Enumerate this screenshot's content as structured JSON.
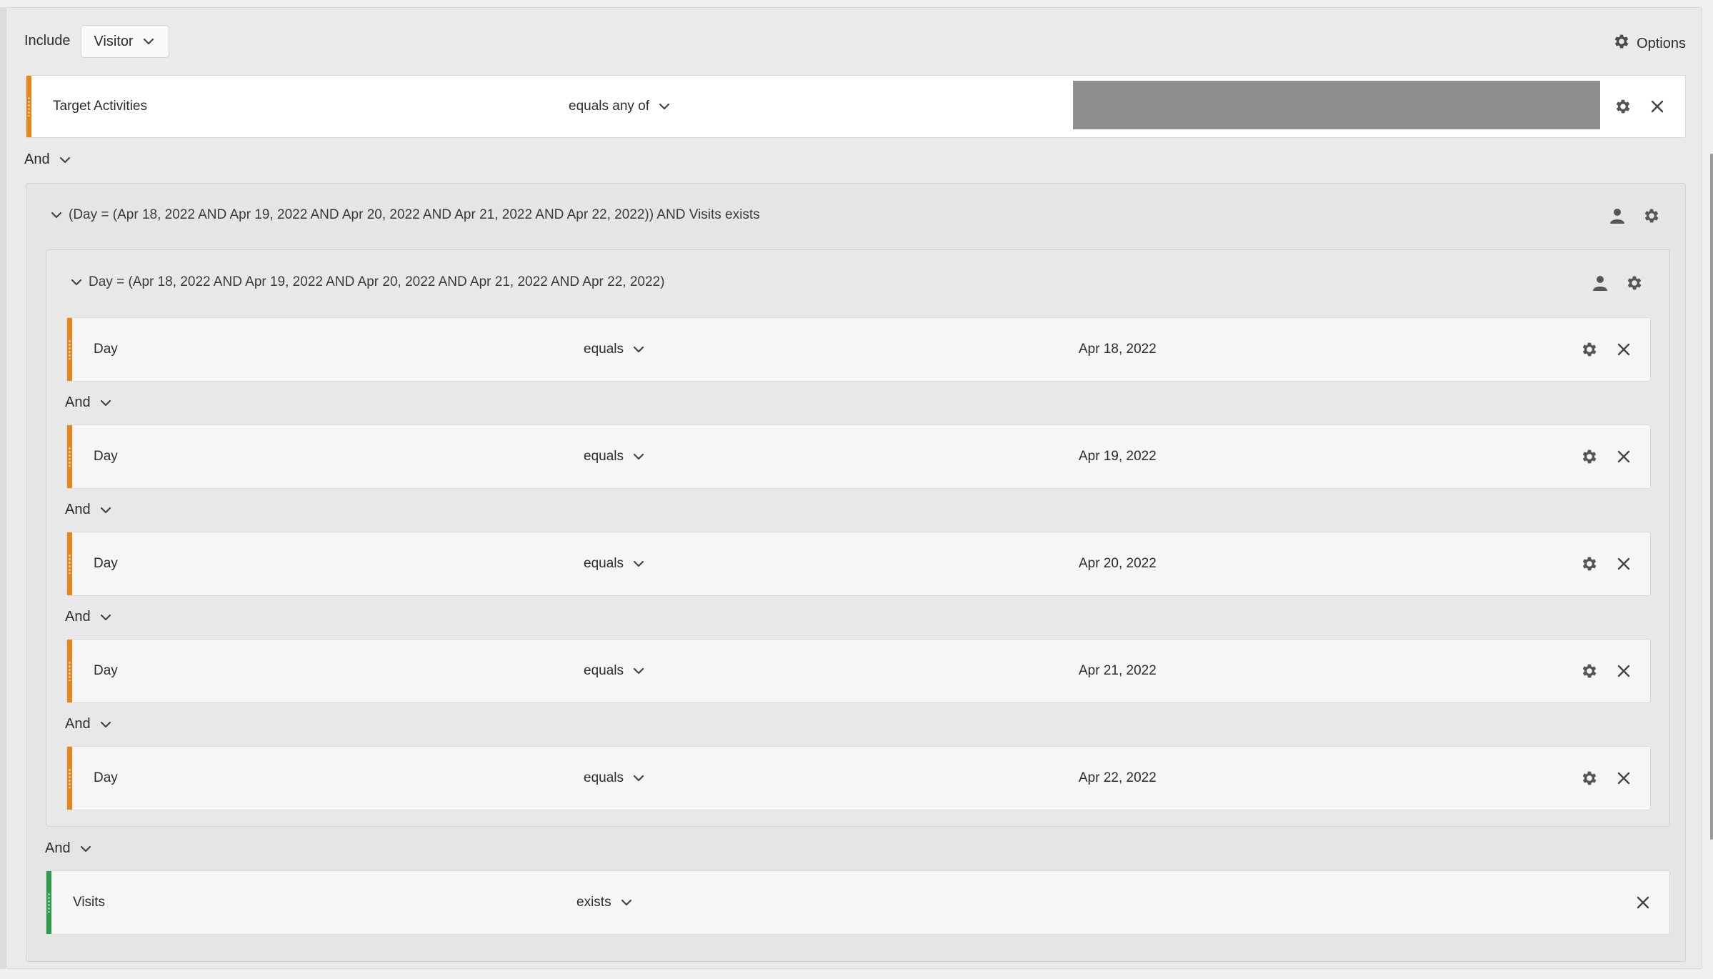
{
  "header": {
    "include_label": "Include",
    "scope_value": "Visitor",
    "options_label": "Options"
  },
  "target_row": {
    "dimension": "Target Activities",
    "operator": "equals any of"
  },
  "outer_container": {
    "title": "(Day = (Apr 18, 2022 AND Apr 19, 2022 AND Apr 20, 2022 AND Apr 21, 2022 AND Apr 22, 2022)) AND Visits exists"
  },
  "inner_container": {
    "title": "Day = (Apr 18, 2022 AND Apr 19, 2022 AND Apr 20, 2022 AND Apr 21, 2022 AND Apr 22, 2022)"
  },
  "connector": "And",
  "day_rows": [
    {
      "dimension": "Day",
      "operator": "equals",
      "value": "Apr 18, 2022"
    },
    {
      "dimension": "Day",
      "operator": "equals",
      "value": "Apr 19, 2022"
    },
    {
      "dimension": "Day",
      "operator": "equals",
      "value": "Apr 20, 2022"
    },
    {
      "dimension": "Day",
      "operator": "equals",
      "value": "Apr 21, 2022"
    },
    {
      "dimension": "Day",
      "operator": "equals",
      "value": "Apr 22, 2022"
    }
  ],
  "visits_row": {
    "dimension": "Visits",
    "operator": "exists"
  },
  "colors": {
    "handle_orange": "#e68619",
    "handle_green": "#2d9d4c",
    "redacted_gray": "#8f8f8f"
  },
  "icons": [
    "chevron-down-icon",
    "gear-icon",
    "close-icon",
    "person-icon",
    "drag-handle-icon"
  ]
}
